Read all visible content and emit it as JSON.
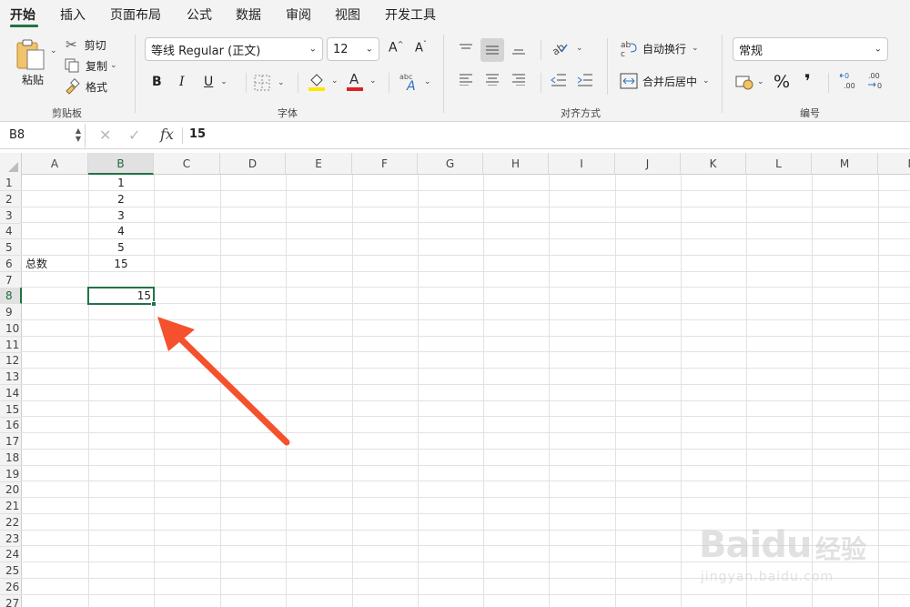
{
  "ribbon_tabs": [
    {
      "label": "开始",
      "active": true
    },
    {
      "label": "插入",
      "active": false
    },
    {
      "label": "页面布局",
      "active": false
    },
    {
      "label": "公式",
      "active": false
    },
    {
      "label": "数据",
      "active": false
    },
    {
      "label": "审阅",
      "active": false
    },
    {
      "label": "视图",
      "active": false
    },
    {
      "label": "开发工具",
      "active": false
    }
  ],
  "clipboard": {
    "paste_label": "粘贴",
    "cut_label": "剪切",
    "copy_label": "复制",
    "format_label": "格式",
    "group_label": "剪贴板"
  },
  "font": {
    "font_name": "等线 Regular (正文)",
    "font_size": "12",
    "bold": "B",
    "italic": "I",
    "underline": "U",
    "group_label": "字体"
  },
  "alignment": {
    "wrap_label": "自动换行",
    "merge_label": "合并后居中",
    "group_label": "对齐方式"
  },
  "number": {
    "format": "常规",
    "percent": "%",
    "comma": "❜",
    "group_label": "编号"
  },
  "formula_bar": {
    "name_box": "B8",
    "fx": "fx",
    "value": "15"
  },
  "columns": [
    "A",
    "B",
    "C",
    "D",
    "E",
    "F",
    "G",
    "H",
    "I",
    "J",
    "K",
    "L",
    "M",
    "N"
  ],
  "rows": [
    "1",
    "2",
    "3",
    "4",
    "5",
    "6",
    "7",
    "8",
    "9",
    "10",
    "11",
    "12",
    "13",
    "14",
    "15",
    "16",
    "17",
    "18",
    "19",
    "20",
    "21",
    "22",
    "23",
    "24",
    "25",
    "26",
    "27"
  ],
  "cells": {
    "B1": "1",
    "B2": "2",
    "B3": "3",
    "B4": "4",
    "B5": "5",
    "A6": "总数",
    "B6": "15",
    "B8": "15"
  },
  "selected_cell": "B8",
  "watermark": {
    "logo": "Baidu",
    "cn": "经验",
    "url": "jingyan.baidu.com"
  },
  "colors": {
    "accent_green": "#217346",
    "arrow_red": "#f4512c",
    "font_color_red": "#e02020",
    "highlight_yellow": "#ffe800"
  }
}
